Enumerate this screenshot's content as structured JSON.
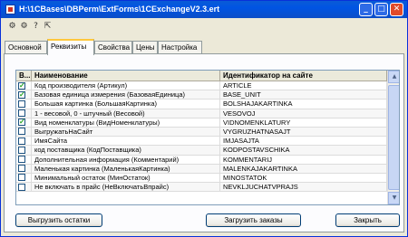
{
  "window": {
    "title": "H:\\1CBases\\DBPerm\\ExtForms\\1CExchangeV2.3.ert",
    "controls": {
      "minimize": "_",
      "maximize": "□",
      "close": "✕"
    }
  },
  "toolbar": {
    "icons": [
      "users-icon",
      "users-settings-icon",
      "help-icon",
      "pointer-help-icon"
    ],
    "glyphs": [
      "⚙",
      "⚙",
      "?",
      "⇱"
    ]
  },
  "tabs": [
    {
      "label": "Основной",
      "active": false
    },
    {
      "label": "Реквизиты",
      "active": true
    },
    {
      "label": "Свойства",
      "active": false
    },
    {
      "label": "Цены",
      "active": false
    },
    {
      "label": "Настройка",
      "active": false
    }
  ],
  "grid": {
    "columns": {
      "check": "В...",
      "name": "Наименование",
      "site_id": "Идентификатор на сайте"
    },
    "rows": [
      {
        "checked": true,
        "name": "Код производителя (Артикул)",
        "site_id": "ARTICLE"
      },
      {
        "checked": true,
        "name": "Базовая единица измерения (БазоваяЕдиница)",
        "site_id": "BASE_UNIT"
      },
      {
        "checked": false,
        "name": "Большая картинка (БольшаяКартинка)",
        "site_id": "BOLSHAJAKARTINKA"
      },
      {
        "checked": false,
        "name": "1 - весовой, 0 - штучный (Весовой)",
        "site_id": "VESOVOJ"
      },
      {
        "checked": true,
        "name": "Вид номенклатуры (ВидНоменклатуры)",
        "site_id": "VIDNOMENKLATURY"
      },
      {
        "checked": false,
        "name": "ВыгружатьНаСайт",
        "site_id": "VYGRUZHATNASAJT"
      },
      {
        "checked": false,
        "name": "ИмяСайта",
        "site_id": "IMJASAJTA"
      },
      {
        "checked": false,
        "name": "код поставщика (КодПоставщика)",
        "site_id": "KODPOSTAVSCHIKA"
      },
      {
        "checked": false,
        "name": "Дополнительная информация (Комментарий)",
        "site_id": "KOMMENTARIJ"
      },
      {
        "checked": false,
        "name": "Маленькая картинка (МаленькаяКартинка)",
        "site_id": "MALENKAJAKARTINKA"
      },
      {
        "checked": false,
        "name": "Минимальный остаток (МинОстаток)",
        "site_id": "MINOSTATOK"
      },
      {
        "checked": false,
        "name": "Не включать в прайс (НеВключатьВпрайс)",
        "site_id": "NEVKLJUCHATVPRAJS"
      }
    ]
  },
  "buttons": {
    "export": "Выгрузить остатки",
    "import_orders": "Загрузить заказы",
    "close": "Закрыть"
  }
}
